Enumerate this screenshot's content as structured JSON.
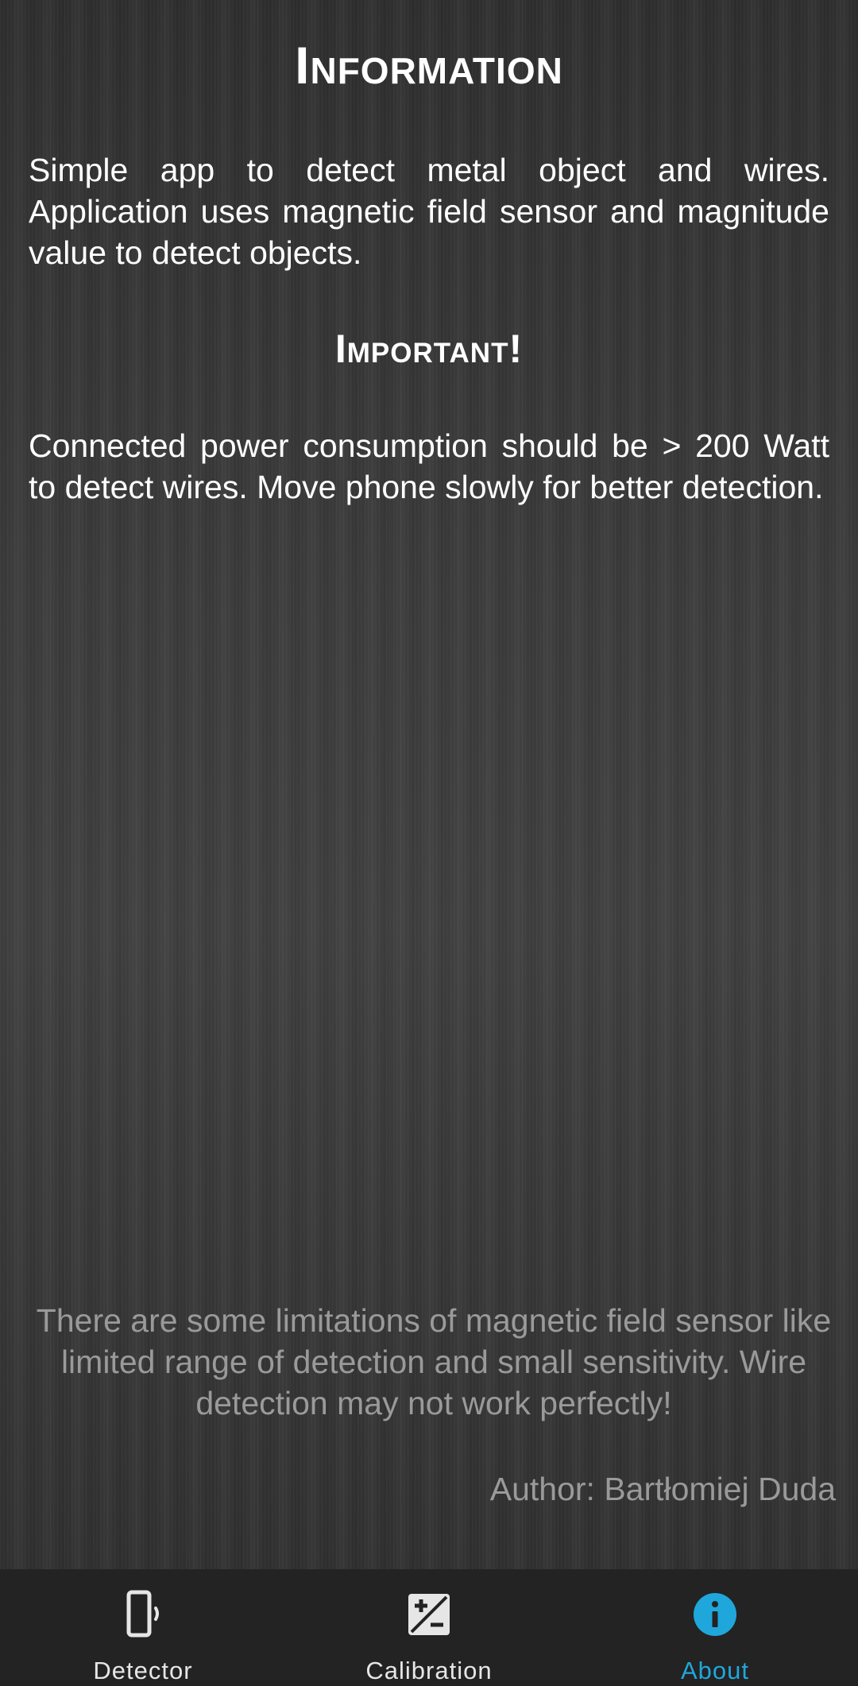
{
  "info": {
    "title": "Information",
    "description": "Simple app to detect metal object and wires. Application uses magnetic field sensor and magnitude value to detect objects."
  },
  "important": {
    "title": "Important!",
    "description": "Connected power consumption should be > 200 Watt to detect wires. Move phone slowly for better detection."
  },
  "limitations": "There are some limitations of magnetic field sensor like limited range of detection and small sensitivity. Wire detection may not work perfectly!",
  "author": "Author: Bartłomiej Duda",
  "bottom_nav": {
    "items": [
      {
        "label": "Detector",
        "icon": "phone-vibrate-icon",
        "active": false
      },
      {
        "label": "Calibration",
        "icon": "exposure-icon",
        "active": false
      },
      {
        "label": "About",
        "icon": "info-icon",
        "active": true
      }
    ]
  },
  "colors": {
    "accent": "#1fa7dc",
    "nav_background": "#232323",
    "muted_text": "#9a9a9a"
  }
}
